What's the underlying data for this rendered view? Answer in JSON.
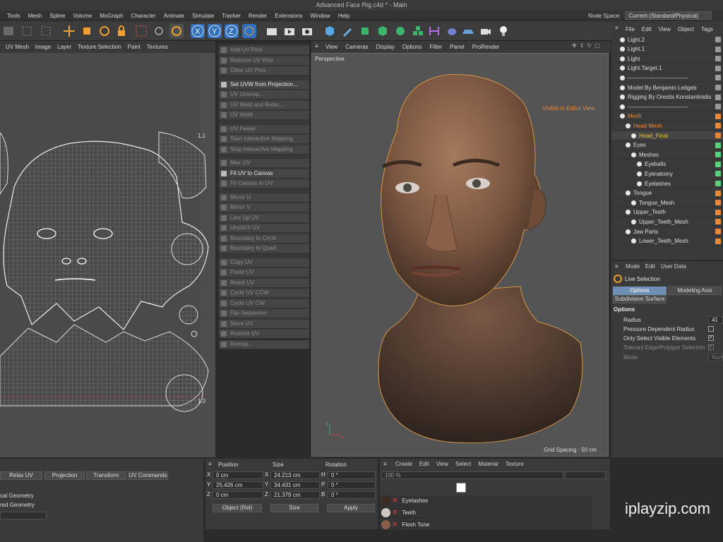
{
  "window": {
    "title": "Advanced Face Rig.c4d * - Main"
  },
  "menubar": {
    "items": [
      "Tools",
      "Mesh",
      "Spline",
      "Volume",
      "MoGraph",
      "Character",
      "Animate",
      "Simulate",
      "Tracker",
      "Render",
      "Extensions",
      "Window",
      "Help"
    ],
    "node_space_label": "Node Space:",
    "node_space_value": "Current (Standard/Physical)"
  },
  "uv_editor": {
    "menu": [
      "UV Mesh",
      "Image",
      "Layer",
      "Texture Selection",
      "Paint",
      "Textures"
    ],
    "corner_top": "1,1",
    "corner_bottom": "1,0"
  },
  "uv_commands": [
    {
      "label": "Add UV Pins",
      "enabled": false
    },
    {
      "label": "Remove UV Pins",
      "enabled": false
    },
    {
      "label": "Clear UV Pins",
      "enabled": false
    },
    {
      "label": "Set UVW from Projection...",
      "enabled": true
    },
    {
      "label": "UV Unwrap...",
      "enabled": false
    },
    {
      "label": "UV Weld and Relax...",
      "enabled": false
    },
    {
      "label": "UV Weld",
      "enabled": false
    },
    {
      "label": "UV Peeler",
      "enabled": false
    },
    {
      "label": "Start Interactive Mapping",
      "enabled": false
    },
    {
      "label": "Stop Interactive Mapping",
      "enabled": false
    },
    {
      "label": "Max UV",
      "enabled": false
    },
    {
      "label": "Fit UV to Canvas",
      "enabled": true
    },
    {
      "label": "Fit Canvas to UV",
      "enabled": false
    },
    {
      "label": "Mirror U",
      "enabled": false
    },
    {
      "label": "Mirror V",
      "enabled": false
    },
    {
      "label": "Line Up UV",
      "enabled": false
    },
    {
      "label": "Unstitch UV",
      "enabled": false
    },
    {
      "label": "Boundary to Circle",
      "enabled": false
    },
    {
      "label": "Boundary to Quad",
      "enabled": false
    },
    {
      "label": "Copy UV",
      "enabled": false
    },
    {
      "label": "Paste UV",
      "enabled": false
    },
    {
      "label": "Reset UV",
      "enabled": false
    },
    {
      "label": "Cycle UV CCW",
      "enabled": false
    },
    {
      "label": "Cycle UV CW",
      "enabled": false
    },
    {
      "label": "Flip Sequence",
      "enabled": false
    },
    {
      "label": "Store UV",
      "enabled": false
    },
    {
      "label": "Restore UV",
      "enabled": false
    },
    {
      "label": "Remap...",
      "enabled": false
    }
  ],
  "viewport": {
    "menu": [
      "View",
      "Cameras",
      "Display",
      "Options",
      "Filter",
      "Panel",
      "ProRender"
    ],
    "camera": "Perspective",
    "visible_label": "Visible in Editor View",
    "grid_spacing": "Grid Spacing : 50 cm"
  },
  "object_manager": {
    "menu": [
      "File",
      "Edit",
      "View",
      "Object",
      "Tags"
    ],
    "objects": [
      {
        "name": "Light.2",
        "indent": 0,
        "color": "#dcdcdc"
      },
      {
        "name": "Light.1",
        "indent": 0,
        "color": "#dcdcdc"
      },
      {
        "name": "Light",
        "indent": 0,
        "color": "#dcdcdc"
      },
      {
        "name": "Light.Target.1",
        "indent": 0,
        "color": "#dcdcdc"
      },
      {
        "name": "--------------------------------",
        "indent": 0,
        "color": "#dcdcdc"
      },
      {
        "name": "Model By Benjamin Leitgeb",
        "indent": 0,
        "color": "#dcdcdc"
      },
      {
        "name": "Rigging By Orestis Konstantinidis",
        "indent": 0,
        "color": "#dcdcdc"
      },
      {
        "name": "--------------------------------",
        "indent": 0,
        "color": "#dcdcdc"
      },
      {
        "name": "Mesh",
        "indent": 0,
        "color": "#e8883a"
      },
      {
        "name": "Head Mesh",
        "indent": 1,
        "color": "#e8883a"
      },
      {
        "name": "Head_Final",
        "indent": 2,
        "color": "#f0c23c"
      },
      {
        "name": "Eyes",
        "indent": 1,
        "color": "#dcdcdc"
      },
      {
        "name": "Meshes",
        "indent": 2,
        "color": "#dcdcdc"
      },
      {
        "name": "Eyeballs",
        "indent": 3,
        "color": "#dcdcdc"
      },
      {
        "name": "Eyenatomy",
        "indent": 3,
        "color": "#dcdcdc"
      },
      {
        "name": "Eyelashes",
        "indent": 3,
        "color": "#dcdcdc"
      },
      {
        "name": "Tongue",
        "indent": 1,
        "color": "#dcdcdc"
      },
      {
        "name": "Tongue_Mesh",
        "indent": 2,
        "color": "#dcdcdc"
      },
      {
        "name": "Upper_Teeth",
        "indent": 1,
        "color": "#dcdcdc"
      },
      {
        "name": "Upper_Teeth_Mesh",
        "indent": 2,
        "color": "#dcdcdc"
      },
      {
        "name": "Jaw Parts",
        "indent": 1,
        "color": "#dcdcdc"
      },
      {
        "name": "Lower_Teeth_Mesh",
        "indent": 2,
        "color": "#dcdcdc"
      }
    ]
  },
  "attributes": {
    "menu": [
      "Mode",
      "Edit",
      "User Data"
    ],
    "tool": "Live Selection",
    "tabs": [
      "Options",
      "Modeling Axis"
    ],
    "subtab": "Subdivision Surface",
    "section": "Options",
    "fields": [
      {
        "label": "Radius",
        "value": "41"
      },
      {
        "label": "Pressure Dependent Radius",
        "value": ""
      },
      {
        "label": "Only Select Visible Elements",
        "value": "checked"
      },
      {
        "label": "Tolerant Edge/Polygon Selection",
        "value": "checked"
      },
      {
        "label": "Mode",
        "value": "Norm"
      }
    ]
  },
  "uv_bottom": {
    "tabs": [
      "Relax UV",
      "Projection",
      "Transform",
      "UV Commands"
    ],
    "lines": [
      "cal Geometry",
      "red Geometry"
    ]
  },
  "coordinates": {
    "headers": [
      "Position",
      "Size",
      "Rotation"
    ],
    "rows": [
      {
        "axis": "X",
        "pos": "0 cm",
        "size_axis": "X",
        "size": "24.213 cm",
        "rot_axis": "H",
        "rot": "0 °"
      },
      {
        "axis": "Y",
        "pos": "25.426 cm",
        "size_axis": "Y",
        "size": "34.431 cm",
        "rot_axis": "P",
        "rot": "0 °"
      },
      {
        "axis": "Z",
        "pos": "0 cm",
        "size_axis": "Z",
        "size": "21.379 cm",
        "rot_axis": "B",
        "rot": "0 °"
      }
    ],
    "mode": "Object (Rel)",
    "size_mode": "Size",
    "apply": "Apply"
  },
  "materials": {
    "menu": [
      "Create",
      "Edit",
      "View",
      "Select",
      "Material",
      "Texture"
    ],
    "zoom": "100 %",
    "items": [
      "Eyelashes",
      "Teeth",
      "Flesh Tone"
    ]
  },
  "watermark": "iplayzip.com"
}
